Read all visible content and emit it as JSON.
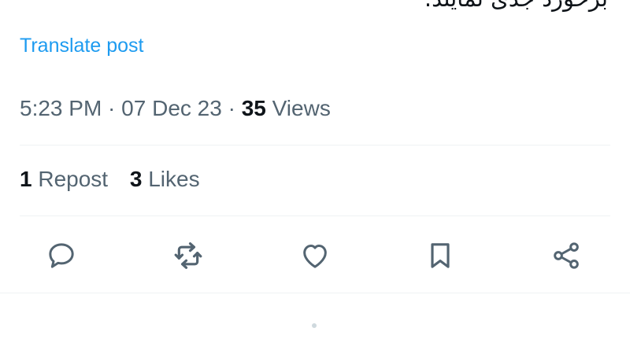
{
  "post": {
    "text_fragment": "برخورد جدی نمایند."
  },
  "translate": {
    "label": "Translate post"
  },
  "meta": {
    "time": "5:23 PM",
    "sep1": " · ",
    "date": "07 Dec 23",
    "sep2": " · ",
    "views_count": "35",
    "views_label": " Views"
  },
  "stats": {
    "reposts_count": "1",
    "reposts_label": " Repost",
    "likes_count": "3",
    "likes_label": " Likes"
  },
  "actions": [
    {
      "name": "reply",
      "icon": "reply-icon"
    },
    {
      "name": "repost",
      "icon": "repost-icon"
    },
    {
      "name": "like",
      "icon": "heart-icon"
    },
    {
      "name": "bookmark",
      "icon": "bookmark-icon"
    },
    {
      "name": "share",
      "icon": "share-icon"
    }
  ],
  "colors": {
    "accent": "#1d9bf0",
    "secondary_text": "#536471",
    "primary_text": "#0f1419",
    "divider": "#eff3f4"
  }
}
